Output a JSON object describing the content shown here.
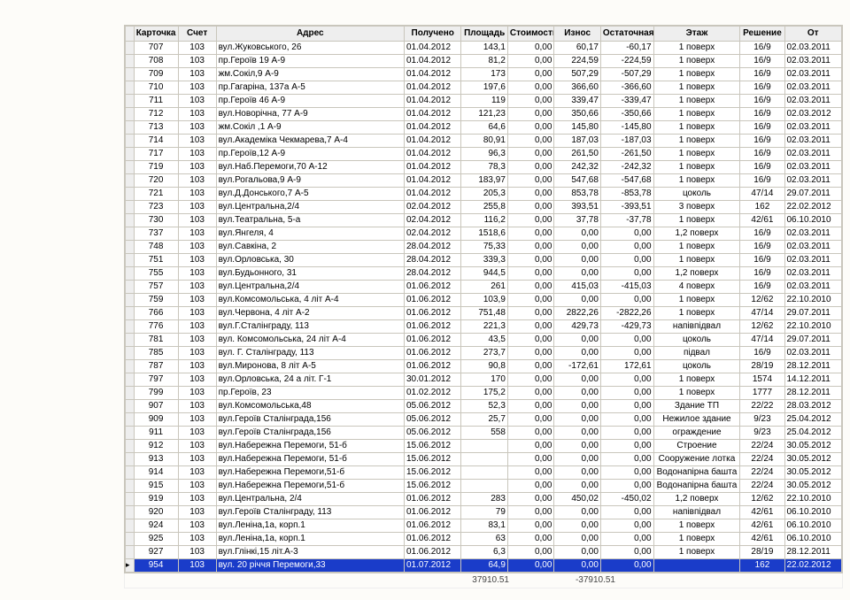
{
  "columns": [
    {
      "key": "kart",
      "label": "Карточка"
    },
    {
      "key": "schet",
      "label": "Счет"
    },
    {
      "key": "adres",
      "label": "Адрес"
    },
    {
      "key": "poluch",
      "label": "Получено"
    },
    {
      "key": "plosh",
      "label": "Площадь"
    },
    {
      "key": "stoim",
      "label": "Стоимость"
    },
    {
      "key": "iznos",
      "label": "Износ"
    },
    {
      "key": "ostat",
      "label": "Остаточная"
    },
    {
      "key": "etazh",
      "label": "Этаж"
    },
    {
      "key": "resh",
      "label": "Решение"
    },
    {
      "key": "ot",
      "label": "От"
    }
  ],
  "rows": [
    {
      "kart": "707",
      "schet": "103",
      "adres": "вул.Жуковського, 26",
      "poluch": "01.04.2012",
      "plosh": "143,1",
      "stoim": "0,00",
      "iznos": "60,17",
      "ostat": "-60,17",
      "etazh": "1 поверх",
      "resh": "16/9",
      "ot": "02.03.2011"
    },
    {
      "kart": "708",
      "schet": "103",
      "adres": "пр.Героїв 19          А-9",
      "poluch": "01.04.2012",
      "plosh": "81,2",
      "stoim": "0,00",
      "iznos": "224,59",
      "ostat": "-224,59",
      "etazh": "1 поверх",
      "resh": "16/9",
      "ot": "02.03.2011"
    },
    {
      "kart": "709",
      "schet": "103",
      "adres": "жм.Сокіл,9          А-9",
      "poluch": "01.04.2012",
      "plosh": "173",
      "stoim": "0,00",
      "iznos": "507,29",
      "ostat": "-507,29",
      "etazh": "1 поверх",
      "resh": "16/9",
      "ot": "02.03.2011"
    },
    {
      "kart": "710",
      "schet": "103",
      "adres": "пр.Гагаріна, 137а      А-5",
      "poluch": "01.04.2012",
      "plosh": "197,6",
      "stoim": "0,00",
      "iznos": "366,60",
      "ostat": "-366,60",
      "etazh": "1 поверх",
      "resh": "16/9",
      "ot": "02.03.2011"
    },
    {
      "kart": "711",
      "schet": "103",
      "adres": "пр.Героїв 46          А-9",
      "poluch": "01.04.2012",
      "plosh": "119",
      "stoim": "0,00",
      "iznos": "339,47",
      "ostat": "-339,47",
      "etazh": "1 поверх",
      "resh": "16/9",
      "ot": "02.03.2011"
    },
    {
      "kart": "712",
      "schet": "103",
      "adres": "вул.Новорічна, 77     А-9",
      "poluch": "01.04.2012",
      "plosh": "121,23",
      "stoim": "0,00",
      "iznos": "350,66",
      "ostat": "-350,66",
      "etazh": "1 поверх",
      "resh": "16/9",
      "ot": "02.03.2012"
    },
    {
      "kart": "713",
      "schet": "103",
      "adres": "жм.Сокіл ,1          А-9",
      "poluch": "01.04.2012",
      "plosh": "64,6",
      "stoim": "0,00",
      "iznos": "145,80",
      "ostat": "-145,80",
      "etazh": "1 поверх",
      "resh": "16/9",
      "ot": "02.03.2011"
    },
    {
      "kart": "714",
      "schet": "103",
      "adres": "вул.Академіка Чекмарева,7     А-4",
      "poluch": "01.04.2012",
      "plosh": "80,91",
      "stoim": "0,00",
      "iznos": "187,03",
      "ostat": "-187,03",
      "etazh": "1 поверх",
      "resh": "16/9",
      "ot": "02.03.2011"
    },
    {
      "kart": "717",
      "schet": "103",
      "adres": "пр.Героїв,12          А-9",
      "poluch": "01.04.2012",
      "plosh": "96,3",
      "stoim": "0,00",
      "iznos": "261,50",
      "ostat": "-261,50",
      "etazh": "1 поверх",
      "resh": "16/9",
      "ot": "02.03.2011"
    },
    {
      "kart": "719",
      "schet": "103",
      "adres": "вул.Наб.Перемоги,70    А-12",
      "poluch": "01.04.2012",
      "plosh": "78,3",
      "stoim": "0,00",
      "iznos": "242,32",
      "ostat": "-242,32",
      "etazh": "1 поверх",
      "resh": "16/9",
      "ot": "02.03.2011"
    },
    {
      "kart": "720",
      "schet": "103",
      "adres": "вул.Рогальова,9     А-9",
      "poluch": "01.04.2012",
      "plosh": "183,97",
      "stoim": "0,00",
      "iznos": "547,68",
      "ostat": "-547,68",
      "etazh": "1 поверх",
      "resh": "16/9",
      "ot": "02.03.2011"
    },
    {
      "kart": "721",
      "schet": "103",
      "adres": "вул.Д.Донського,7     А-5",
      "poluch": "01.04.2012",
      "plosh": "205,3",
      "stoim": "0,00",
      "iznos": "853,78",
      "ostat": "-853,78",
      "etazh": "цоколь",
      "resh": "47/14",
      "ot": "29.07.2011"
    },
    {
      "kart": "723",
      "schet": "103",
      "adres": "вул.Центральна,2/4",
      "poluch": "02.04.2012",
      "plosh": "255,8",
      "stoim": "0,00",
      "iznos": "393,51",
      "ostat": "-393,51",
      "etazh": "3 поверх",
      "resh": "162",
      "ot": "22.02.2012"
    },
    {
      "kart": "730",
      "schet": "103",
      "adres": "вул.Театральна, 5-а",
      "poluch": "02.04.2012",
      "plosh": "116,2",
      "stoim": "0,00",
      "iznos": "37,78",
      "ostat": "-37,78",
      "etazh": "1 поверх",
      "resh": "42/61",
      "ot": "06.10.2010"
    },
    {
      "kart": "737",
      "schet": "103",
      "adres": "вул.Янгеля, 4",
      "poluch": "02.04.2012",
      "plosh": "1518,6",
      "stoim": "0,00",
      "iznos": "0,00",
      "ostat": "0,00",
      "etazh": "1,2 поверх",
      "resh": "16/9",
      "ot": "02.03.2011"
    },
    {
      "kart": "748",
      "schet": "103",
      "adres": "вул.Савкіна, 2",
      "poluch": "28.04.2012",
      "plosh": "75,33",
      "stoim": "0,00",
      "iznos": "0,00",
      "ostat": "0,00",
      "etazh": "1 поверх",
      "resh": "16/9",
      "ot": "02.03.2011"
    },
    {
      "kart": "751",
      "schet": "103",
      "adres": "вул.Орловська, 30",
      "poluch": "28.04.2012",
      "plosh": "339,3",
      "stoim": "0,00",
      "iznos": "0,00",
      "ostat": "0,00",
      "etazh": "1 поверх",
      "resh": "16/9",
      "ot": "02.03.2011"
    },
    {
      "kart": "755",
      "schet": "103",
      "adres": "вул.Будьонного, 31",
      "poluch": "28.04.2012",
      "plosh": "944,5",
      "stoim": "0,00",
      "iznos": "0,00",
      "ostat": "0,00",
      "etazh": "1,2 поверх",
      "resh": "16/9",
      "ot": "02.03.2011"
    },
    {
      "kart": "757",
      "schet": "103",
      "adres": "вул.Центральна,2/4",
      "poluch": "01.06.2012",
      "plosh": "261",
      "stoim": "0,00",
      "iznos": "415,03",
      "ostat": "-415,03",
      "etazh": "4 поверх",
      "resh": "16/9",
      "ot": "02.03.2011"
    },
    {
      "kart": "759",
      "schet": "103",
      "adres": "вул.Комсомольська, 4   літ А-4",
      "poluch": "01.06.2012",
      "plosh": "103,9",
      "stoim": "0,00",
      "iznos": "0,00",
      "ostat": "0,00",
      "etazh": "1 поверх",
      "resh": "12/62",
      "ot": "22.10.2010"
    },
    {
      "kart": "766",
      "schet": "103",
      "adres": "вул.Червона, 4   літ А-2",
      "poluch": "01.06.2012",
      "plosh": "751,48",
      "stoim": "0,00",
      "iznos": "2822,26",
      "ostat": "-2822,26",
      "etazh": "1 поверх",
      "resh": "47/14",
      "ot": "29.07.2011"
    },
    {
      "kart": "776",
      "schet": "103",
      "adres": "вул.Г.Сталінграду, 113",
      "poluch": "01.06.2012",
      "plosh": "221,3",
      "stoim": "0,00",
      "iznos": "429,73",
      "ostat": "-429,73",
      "etazh": "напівпідвал",
      "resh": "12/62",
      "ot": "22.10.2010"
    },
    {
      "kart": "781",
      "schet": "103",
      "adres": "вул. Комсомольська, 24    літ  А-4",
      "poluch": "01.06.2012",
      "plosh": "43,5",
      "stoim": "0,00",
      "iznos": "0,00",
      "ostat": "0,00",
      "etazh": "цоколь",
      "resh": "47/14",
      "ot": "29.07.2011"
    },
    {
      "kart": "785",
      "schet": "103",
      "adres": "вул. Г. Сталінграду, 113",
      "poluch": "01.06.2012",
      "plosh": "273,7",
      "stoim": "0,00",
      "iznos": "0,00",
      "ostat": "0,00",
      "etazh": "підвал",
      "resh": "16/9",
      "ot": "02.03.2011"
    },
    {
      "kart": "787",
      "schet": "103",
      "adres": "вул.Миронова, 8   літ  А-5",
      "poluch": "01.06.2012",
      "plosh": "90,8",
      "stoim": "0,00",
      "iznos": "-172,61",
      "ostat": "172,61",
      "etazh": "цоколь",
      "resh": "28/19",
      "ot": "28.12.2011"
    },
    {
      "kart": "797",
      "schet": "103",
      "adres": "вул.Орловська, 24 а  літ. Г-1",
      "poluch": "30.01.2012",
      "plosh": "170",
      "stoim": "0,00",
      "iznos": "0,00",
      "ostat": "0,00",
      "etazh": "1 поверх",
      "resh": "1574",
      "ot": "14.12.2011"
    },
    {
      "kart": "799",
      "schet": "103",
      "adres": "пр.Героїв, 23",
      "poluch": "01.02.2012",
      "plosh": "175,2",
      "stoim": "0,00",
      "iznos": "0,00",
      "ostat": "0,00",
      "etazh": "1 поверх",
      "resh": "1777",
      "ot": "28.12.2011"
    },
    {
      "kart": "907",
      "schet": "103",
      "adres": "вул.Комсомольська,48",
      "poluch": "05.06.2012",
      "plosh": "52,3",
      "stoim": "0,00",
      "iznos": "0,00",
      "ostat": "0,00",
      "etazh": "Здание ТП",
      "resh": "22/22",
      "ot": "28.03.2012"
    },
    {
      "kart": "909",
      "schet": "103",
      "adres": "вул.Героїв Сталінграда,156",
      "poluch": "05.06.2012",
      "plosh": "25,7",
      "stoim": "0,00",
      "iznos": "0,00",
      "ostat": "0,00",
      "etazh": "Нежилое здание",
      "resh": "9/23",
      "ot": "25.04.2012"
    },
    {
      "kart": "911",
      "schet": "103",
      "adres": "вул.Героїв Сталінграда,156",
      "poluch": "05.06.2012",
      "plosh": "558",
      "stoim": "0,00",
      "iznos": "0,00",
      "ostat": "0,00",
      "etazh": "ограждение",
      "resh": "9/23",
      "ot": "25.04.2012"
    },
    {
      "kart": "912",
      "schet": "103",
      "adres": "вул.Набережна Перемоги, 51-б",
      "poluch": "15.06.2012",
      "plosh": "",
      "stoim": "0,00",
      "iznos": "0,00",
      "ostat": "0,00",
      "etazh": "Строение",
      "resh": "22/24",
      "ot": "30.05.2012"
    },
    {
      "kart": "913",
      "schet": "103",
      "adres": "вул.Набережна Перемоги, 51-б",
      "poluch": "15.06.2012",
      "plosh": "",
      "stoim": "0,00",
      "iznos": "0,00",
      "ostat": "0,00",
      "etazh": "Сооружение лотка",
      "resh": "22/24",
      "ot": "30.05.2012"
    },
    {
      "kart": "914",
      "schet": "103",
      "adres": "вул.Набережна Перемоги,51-б",
      "poluch": "15.06.2012",
      "plosh": "",
      "stoim": "0,00",
      "iznos": "0,00",
      "ostat": "0,00",
      "etazh": "Водонапірна башта",
      "resh": "22/24",
      "ot": "30.05.2012"
    },
    {
      "kart": "915",
      "schet": "103",
      "adres": "вул.Набережна Перемоги,51-б",
      "poluch": "15.06.2012",
      "plosh": "",
      "stoim": "0,00",
      "iznos": "0,00",
      "ostat": "0,00",
      "etazh": "Водонапірна башта",
      "resh": "22/24",
      "ot": "30.05.2012"
    },
    {
      "kart": "919",
      "schet": "103",
      "adres": "вул.Центральна,  2/4",
      "poluch": "01.06.2012",
      "plosh": "283",
      "stoim": "0,00",
      "iznos": "450,02",
      "ostat": "-450,02",
      "etazh": "1,2 поверх",
      "resh": "12/62",
      "ot": "22.10.2010"
    },
    {
      "kart": "920",
      "schet": "103",
      "adres": "вул.Героїв Сталінграду, 113",
      "poluch": "01.06.2012",
      "plosh": "79",
      "stoim": "0,00",
      "iznos": "0,00",
      "ostat": "0,00",
      "etazh": "напівпідвал",
      "resh": "42/61",
      "ot": "06.10.2010"
    },
    {
      "kart": "924",
      "schet": "103",
      "adres": "вул.Леніна,1а, корп.1",
      "poluch": "01.06.2012",
      "plosh": "83,1",
      "stoim": "0,00",
      "iznos": "0,00",
      "ostat": "0,00",
      "etazh": "1 поверх",
      "resh": "42/61",
      "ot": "06.10.2010"
    },
    {
      "kart": "925",
      "schet": "103",
      "adres": "вул.Леніна,1а, корп.1",
      "poluch": "01.06.2012",
      "plosh": "63",
      "stoim": "0,00",
      "iznos": "0,00",
      "ostat": "0,00",
      "etazh": "1 поверх",
      "resh": "42/61",
      "ot": "06.10.2010"
    },
    {
      "kart": "927",
      "schet": "103",
      "adres": "вул.Глінкі,15   літ.А-3",
      "poluch": "01.06.2012",
      "plosh": "6,3",
      "stoim": "0,00",
      "iznos": "0,00",
      "ostat": "0,00",
      "etazh": "1 поверх",
      "resh": "28/19",
      "ot": "28.12.2011"
    },
    {
      "kart": "954",
      "schet": "103",
      "adres": "вул. 20 річчя Перемоги,33",
      "poluch": "01.07.2012",
      "plosh": "64,9",
      "stoim": "0,00",
      "iznos": "0,00",
      "ostat": "0,00",
      "etazh": "",
      "resh": "162",
      "ot": "22.02.2012",
      "selected": true
    }
  ],
  "totals": {
    "ploshad": "37910.51",
    "ostat": "-37910.51"
  }
}
